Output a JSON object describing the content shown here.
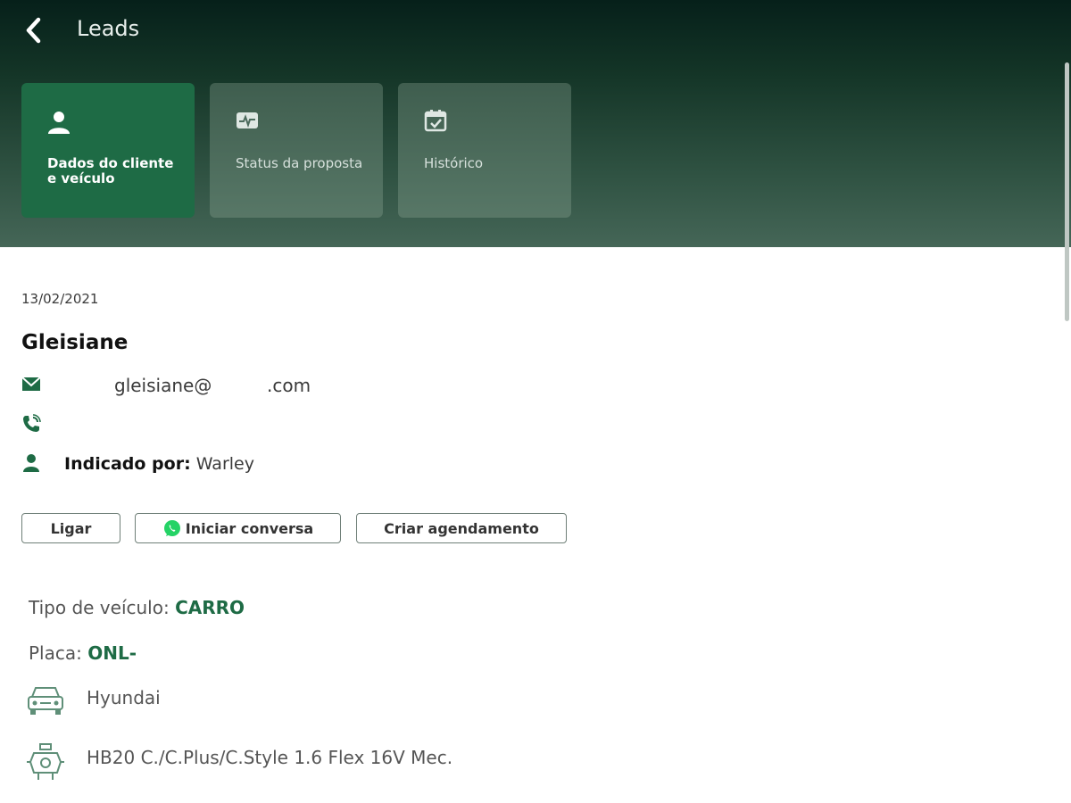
{
  "header": {
    "title": "Leads",
    "tabs": [
      {
        "label": "Dados do cliente e veículo",
        "icon": "person-icon",
        "active": true
      },
      {
        "label": "Status da proposta",
        "icon": "activity-icon",
        "active": false
      },
      {
        "label": "Histórico",
        "icon": "calendar-check-icon",
        "active": false
      }
    ]
  },
  "lead": {
    "date": "13/02/2021",
    "name": "Gleisiane",
    "email_local": "gleisiane@",
    "email_domain": ".com",
    "referred_label": "Indicado por:",
    "referred_by": "Warley"
  },
  "actions": {
    "call": "Ligar",
    "chat": "Iniciar conversa",
    "schedule": "Criar agendamento"
  },
  "vehicle": {
    "type_label": "Tipo de veículo:",
    "type_value": "CARRO",
    "plate_label": "Placa:",
    "plate_value": "ONL-",
    "brand": "Hyundai",
    "model": "HB20 C./C.Plus/C.Style 1.6 Flex 16V Mec."
  },
  "colors": {
    "accent": "#1e6b45",
    "header_dark": "#06201a",
    "whatsapp": "#25d366"
  }
}
